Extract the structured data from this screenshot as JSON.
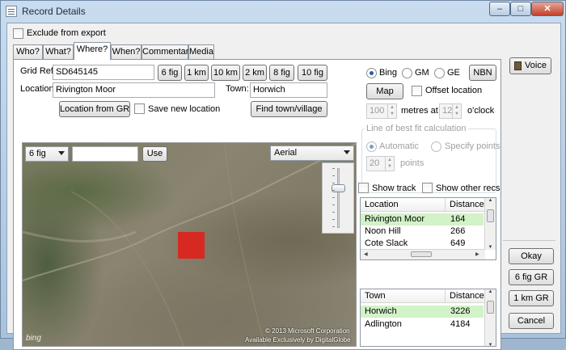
{
  "window": {
    "title": "Record Details",
    "controls": {
      "minimize": "–",
      "maximize": "□",
      "close": "✕"
    }
  },
  "exclude_from_export": {
    "label": "Exclude from export",
    "checked": false
  },
  "tabs": [
    {
      "label": "Who?",
      "active": false
    },
    {
      "label": "What?",
      "active": false
    },
    {
      "label": "Where?",
      "active": true
    },
    {
      "label": "When?",
      "active": false
    },
    {
      "label": "Commentary",
      "active": false
    },
    {
      "label": "Media",
      "active": false
    }
  ],
  "where": {
    "grid_ref_label": "Grid Ref:",
    "grid_ref_value": "SD645145",
    "precision_buttons": [
      "6 fig",
      "1 km",
      "10 km",
      "2 km",
      "8 fig",
      "10 fig"
    ],
    "location_label": "Location:",
    "location_value": "Rivington Moor",
    "town_label": "Town:",
    "town_value": "Horwich",
    "location_from_gr": "Location from GR",
    "save_new_location": "Save new location",
    "find_town": "Find town/village",
    "map_source": {
      "options": [
        "Bing",
        "GM",
        "GE"
      ],
      "selected": "Bing",
      "nbn": "NBN"
    },
    "map_button": "Map",
    "offset_location": "Offset location",
    "offset": {
      "metres": "100",
      "metres_label": "metres at",
      "oclock": "12",
      "oclock_label": "o'clock"
    },
    "best_fit": {
      "title": "Line of best fit calculation",
      "automatic": "Automatic",
      "specify": "Specify points",
      "points_value": "20",
      "points_label": "points"
    },
    "show_track": "Show track",
    "show_other_recs": "Show other recs",
    "map": {
      "precision": "6 fig",
      "use_button": "Use",
      "view": "Aerial",
      "copyright": "© 2013 Microsoft Corporation",
      "copyright2": "Available Exclusively by DigitalGlobe",
      "logo": "bing"
    },
    "location_grid": {
      "columns": [
        "Location",
        "Distance"
      ],
      "rows": [
        {
          "name": "Rivington Moor",
          "distance": "164",
          "selected": true
        },
        {
          "name": "Noon Hill",
          "distance": "266",
          "selected": false
        },
        {
          "name": "Cote Slack",
          "distance": "649",
          "selected": false
        }
      ]
    },
    "town_grid": {
      "columns": [
        "Town",
        "Distance"
      ],
      "rows": [
        {
          "name": "Horwich",
          "distance": "3226",
          "selected": true
        },
        {
          "name": "Adlington",
          "distance": "4184",
          "selected": false
        }
      ]
    }
  },
  "side_buttons": {
    "voice": "Voice",
    "okay": "Okay",
    "six_fig_gr": "6 fig GR",
    "one_km_gr": "1 km GR",
    "cancel": "Cancel"
  },
  "colors": {
    "selected_row": "#d2f2c8",
    "map_square": "#e0201a"
  }
}
